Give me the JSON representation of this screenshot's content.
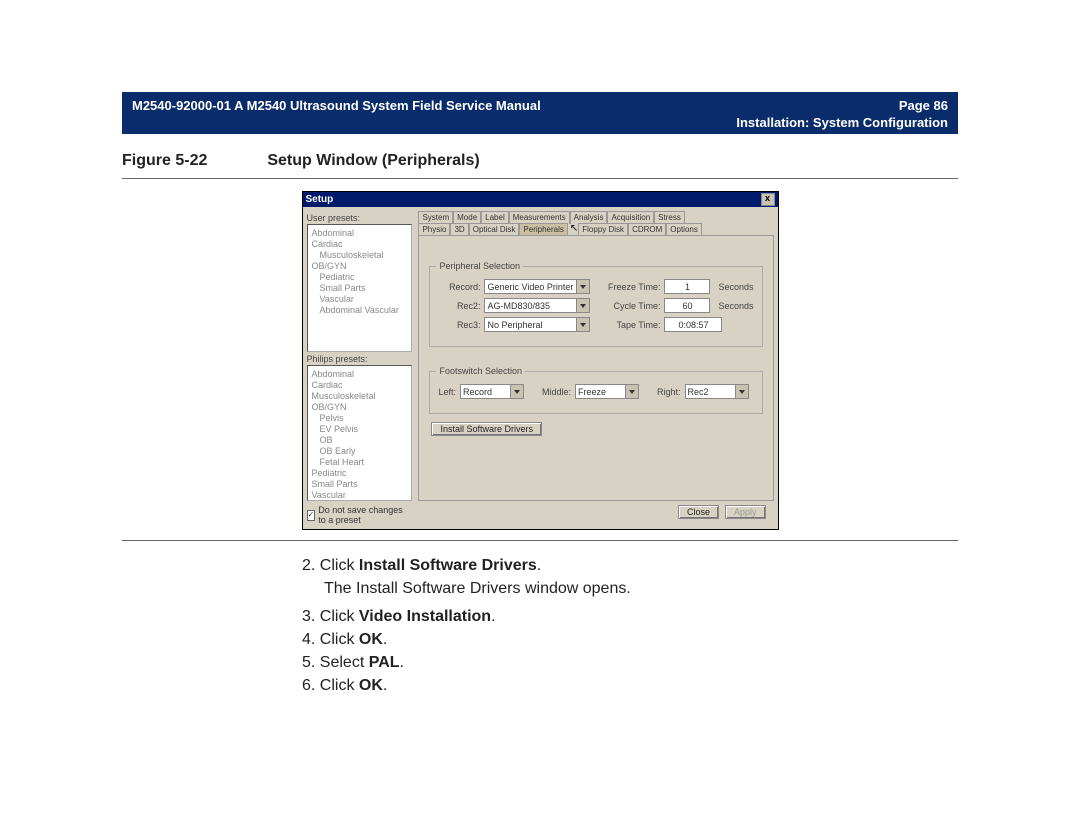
{
  "header": {
    "left": "M2540-92000-01 A M2540 Ultrasound System Field Service Manual",
    "page": "Page 86",
    "section": "Installation: System Configuration"
  },
  "figure": {
    "label": "Figure 5-22",
    "title": "Setup Window (Peripherals)"
  },
  "setup_window": {
    "title": "Setup",
    "close_x": "x",
    "user_presets_label": "User presets:",
    "user_presets": [
      "Abdominal",
      "Cardiac",
      "Musculoskeletal",
      "OB/GYN",
      "Pediatric",
      "Small Parts",
      "Vascular",
      "Abdominal Vascular"
    ],
    "philips_presets_label": "Philips presets:",
    "philips_presets": [
      "Abdominal",
      "Cardiac",
      "Musculoskeletal",
      "OB/GYN",
      "Pelvis",
      "EV Pelvis",
      "OB",
      "OB Early",
      "Fetal Heart",
      "Pediatric",
      "Small Parts",
      "Vascular"
    ],
    "checkbox": "Do not save changes to a preset",
    "checkbox_checked": "✓",
    "tabs_row1": [
      "System",
      "Mode",
      "Label",
      "Measurements",
      "Analysis",
      "Acquisition",
      "Stress"
    ],
    "tabs_row2": [
      "Physio",
      "3D",
      "Optical Disk",
      "Peripherals",
      "Floppy Disk",
      "CDROM",
      "Options"
    ],
    "cursor": "↖",
    "peripheral_group": "Peripheral Selection",
    "footswitch_group": "Footswitch Selection",
    "record_label": "Record:",
    "rec2_label": "Rec2:",
    "rec3_label": "Rec3:",
    "record_val": "Generic Video Printer",
    "rec2_val": "AG-MD830/835",
    "rec3_val": "No Peripheral",
    "freeze_time_label": "Freeze Time:",
    "freeze_time_val": "1",
    "cycle_time_label": "Cycle Time:",
    "cycle_time_val": "60",
    "tape_time_label": "Tape Time:",
    "tape_time_val": "0:08:57",
    "seconds": "Seconds",
    "foot_left_label": "Left:",
    "foot_left_val": "Record",
    "foot_mid_label": "Middle:",
    "foot_mid_val": "Freeze",
    "foot_right_label": "Right:",
    "foot_right_val": "Rec2",
    "install_drivers_btn": "Install Software Drivers",
    "close_btn": "Close",
    "apply_btn": "Apply"
  },
  "instructions": {
    "n2": "2.",
    "l2a": "Click ",
    "l2b": "Install Software Drivers",
    "l2c": ".",
    "sub": "The Install Software Drivers window opens.",
    "n3": "3.",
    "l3a": "Click ",
    "l3b": "Video Installation",
    "l3c": ".",
    "n4": "4.",
    "l4a": "Click ",
    "l4b": "OK",
    "l4c": ".",
    "n5": "5.",
    "l5a": "Select ",
    "l5b": "PAL",
    "l5c": ".",
    "n6": "6.",
    "l6a": "Click ",
    "l6b": "OK",
    "l6c": "."
  }
}
